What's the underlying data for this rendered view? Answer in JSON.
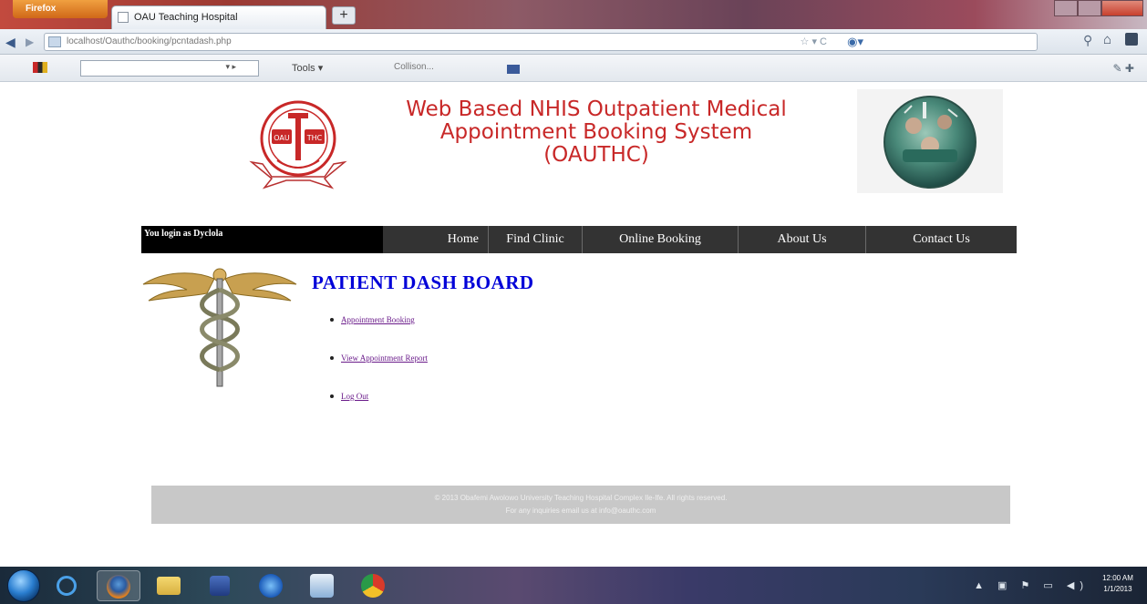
{
  "browser": {
    "menu_button_label": "Firefox",
    "tab_title": "OAU Teaching Hospital",
    "new_tab_symbol": "+",
    "url": "localhost/Oauthc/booking/pcntadash.php",
    "url_actions": "☆ ▾ C",
    "toolbar_tools_label": "Tools ▾",
    "toolbar_text": "Collison...",
    "nav_back_symbol": "◀",
    "nav_forward_symbol": "▶",
    "search_engine_symbol": "◉▾",
    "magnifier_symbol": "⚲",
    "home_symbol": "⌂",
    "toolbar_right_symbols": "✎ ✚"
  },
  "header": {
    "title_line1": "Web Based NHIS Outpatient Medical",
    "title_line2": "Appointment Booking System",
    "title_line3": "(OAUTHC)",
    "logo_text_left": "OAU",
    "logo_text_right": "THC"
  },
  "menu": {
    "login_status": "You login as Dyclola",
    "items": [
      {
        "label": "Home"
      },
      {
        "label": "Find Clinic"
      },
      {
        "label": "Online Booking"
      },
      {
        "label": "About Us"
      },
      {
        "label": "Contact Us"
      }
    ]
  },
  "dashboard": {
    "title": "PATIENT DASH BOARD",
    "links": [
      {
        "label": "Appointment Booking"
      },
      {
        "label": "View Appointment Report"
      },
      {
        "label": "Log Out"
      }
    ]
  },
  "footer": {
    "line1": "© 2013 Obafemi Awolowo University Teaching Hospital Complex Ile-Ife. All rights reserved.",
    "line2": "For any inquiries email us at info@oauthc.com"
  },
  "taskbar": {
    "tray_icons": "▲ ▣ ⚑ ▭ ◀)",
    "clock_time": "12:00 AM",
    "clock_date": "1/1/2013"
  },
  "colors": {
    "title_red": "#c82828",
    "dash_title_blue": "#0000d8",
    "menu_bg": "#333333",
    "link_purple": "#6a1b8a",
    "footer_bg": "#c8c8c8"
  }
}
